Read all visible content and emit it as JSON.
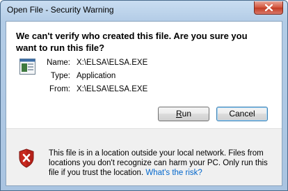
{
  "window": {
    "title": "Open File - Security Warning"
  },
  "dialog": {
    "heading": "We can't verify who created this file. Are you sure you want to run this file?",
    "details": [
      {
        "label": "Name:",
        "value": "X:\\ELSA\\ELSA.EXE"
      },
      {
        "label": "Type:",
        "value": "Application"
      },
      {
        "label": "From:",
        "value": "X:\\ELSA\\ELSA.EXE"
      }
    ],
    "run_label": "Run",
    "cancel_label": "Cancel"
  },
  "warning": {
    "text": "This file is in a location outside your local network. Files from locations you don't recognize can harm your PC. Only run this file if you trust the location. ",
    "link": "What's the risk?"
  },
  "icons": {
    "close": "close-icon",
    "file": "application-file-icon",
    "shield": "security-shield-error-icon"
  },
  "colors": {
    "link": "#0066cc",
    "shield_red": "#c8281e"
  }
}
